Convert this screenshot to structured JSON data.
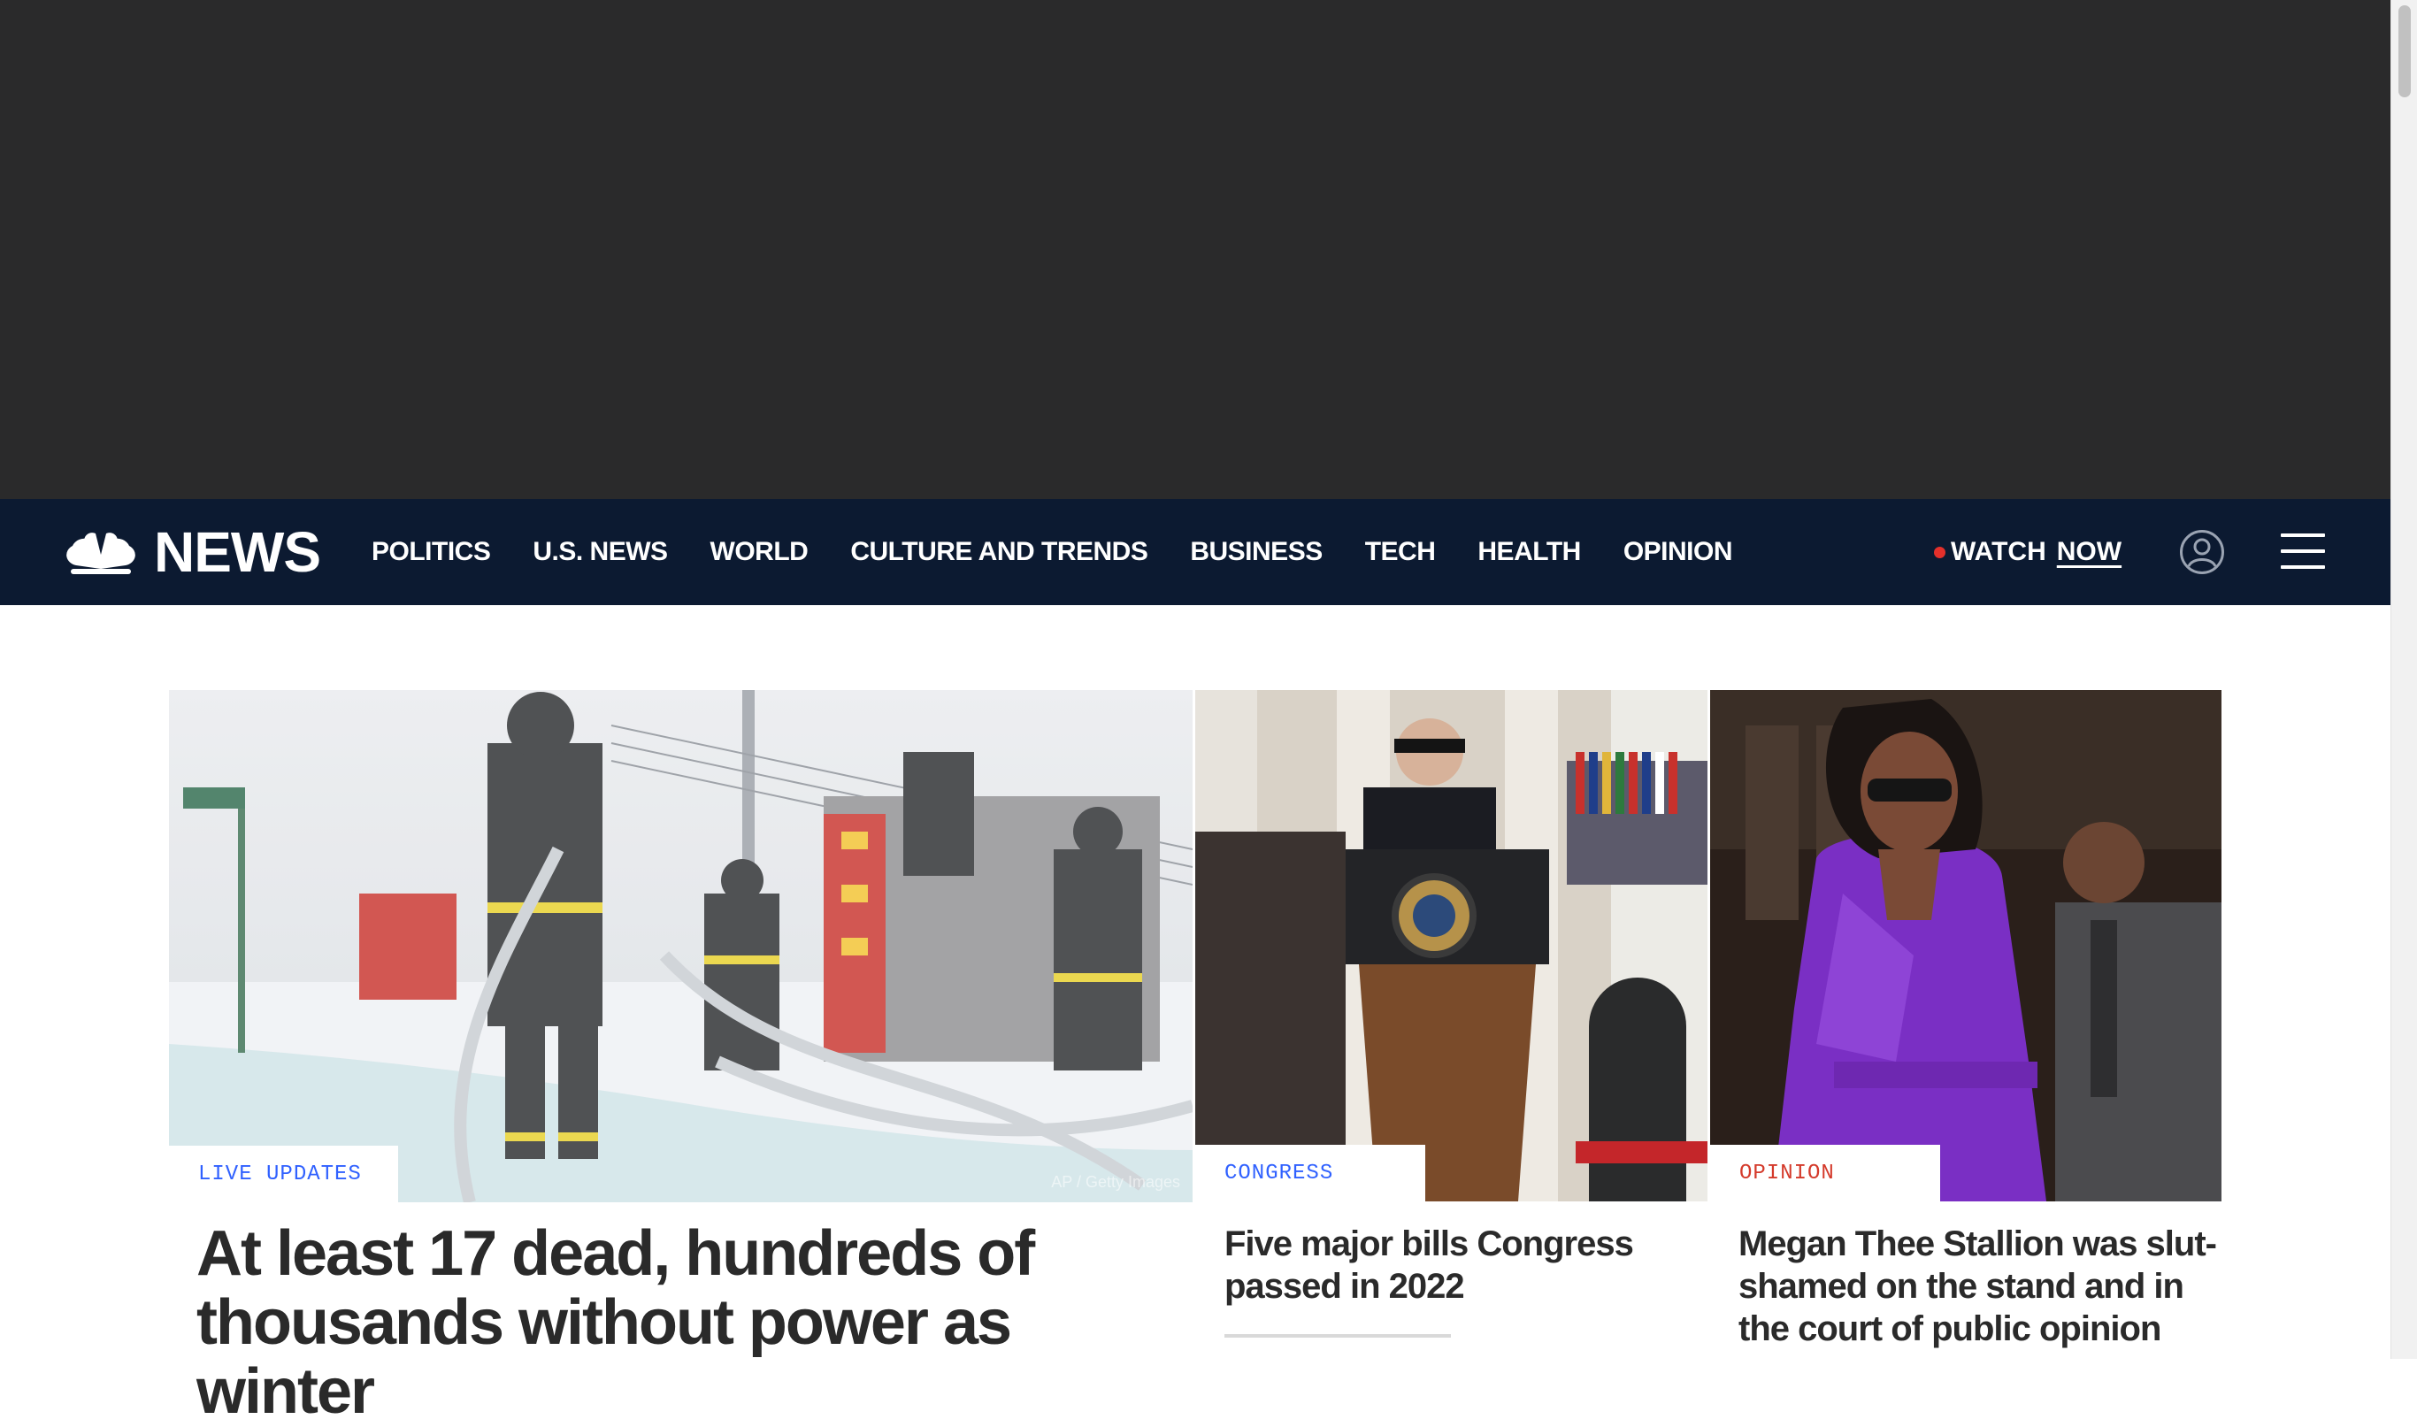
{
  "brand": {
    "name": "NEWS"
  },
  "nav": {
    "links": [
      "POLITICS",
      "U.S. NEWS",
      "WORLD",
      "CULTURE AND TRENDS",
      "BUSINESS",
      "TECH",
      "HEALTH",
      "OPINION"
    ],
    "watch_label": "WATCH",
    "now_label": "NOW"
  },
  "icons": {
    "logo": "nbc-peacock-icon",
    "account": "account-icon",
    "menu": "hamburger-menu-icon",
    "live": "live-dot-icon"
  },
  "colors": {
    "nav_bg": "#0c1a31",
    "ad_bg": "#2a2a2b",
    "label_blue": "#3061ff",
    "label_opinion": "#d43a2b",
    "live_dot": "#e4302b",
    "headline": "#2a2a2a"
  },
  "stories": [
    {
      "label": "LIVE UPDATES",
      "headline": "At least 17 dead, hundreds of thousands without power as winter",
      "image_credit": "AP / Getty Images"
    },
    {
      "label": "CONGRESS",
      "headline": "Five major bills Congress passed in 2022"
    },
    {
      "label": "OPINION",
      "headline": "Megan Thee Stallion was slut-shamed on the stand and in the court of public opinion"
    }
  ]
}
